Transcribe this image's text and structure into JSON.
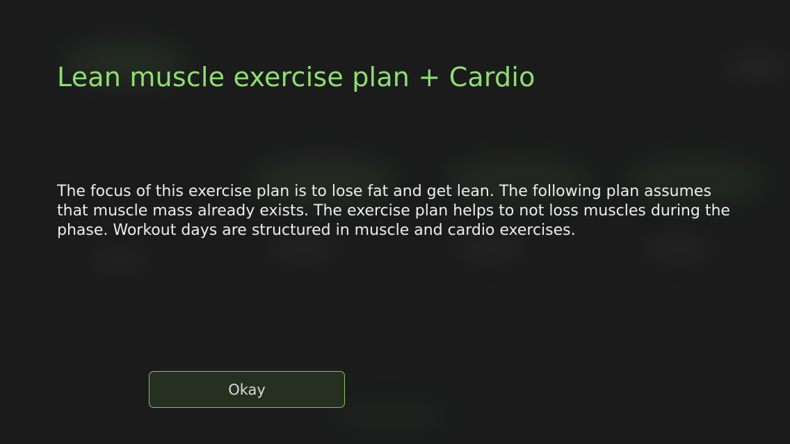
{
  "dialog": {
    "title": "Lean muscle exercise plan + Cardio",
    "description": "The focus of this exercise plan is to lose fat and get lean. The following plan assumes that muscle mass already exists. The exercise plan helps to not loss muscles during the phase. Workout days are structured in muscle and cardio exercises.",
    "okay_label": "Okay"
  },
  "colors": {
    "background": "#1b1b1c",
    "title": "#8ee06e",
    "text": "#ececec",
    "button_border": "#89c25a",
    "button_fill": "#263020"
  }
}
